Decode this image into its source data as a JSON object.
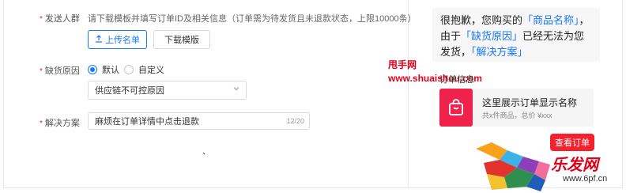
{
  "form": {
    "send_target": {
      "required_mark": "*",
      "label": "发送人群",
      "hint": "请下载模板并填写订单ID及相关信息（订单需为待发货且未退款状态，上限10000条）",
      "upload_button": "上传名单",
      "upload_icon": "upload-icon",
      "download_button": "下载模版"
    },
    "reason": {
      "required_mark": "*",
      "label": "缺货原因",
      "option_default": "默认",
      "option_custom": "自定义",
      "selected": "默认",
      "select_value": "供应链不可控原因"
    },
    "solution": {
      "required_mark": "*",
      "label": "解决方案",
      "value": "麻烦在订单详情中点击退款",
      "counter": "12/20"
    },
    "stray_mark": "、"
  },
  "preview": {
    "message_parts": [
      "很抱歉，您购买的",
      "「商品名称」",
      "，由于",
      "「缺货原因」",
      "已经无法为您发货，",
      "「解决方案」"
    ],
    "detail_label": "订单信息",
    "order_title": "这里展示订单显示名称",
    "order_sub": "共x件商品，总价 ¥xxx",
    "view_button": "查看订单",
    "accent_color": "#1677ff",
    "card_icon_color": "#f0224b",
    "button_color": "#f5222d"
  },
  "watermark": {
    "line1": "甩手网",
    "line2": "www.shuaishou.com",
    "logo_text": "乐发网",
    "logo_url": "www.6pf.cn"
  }
}
